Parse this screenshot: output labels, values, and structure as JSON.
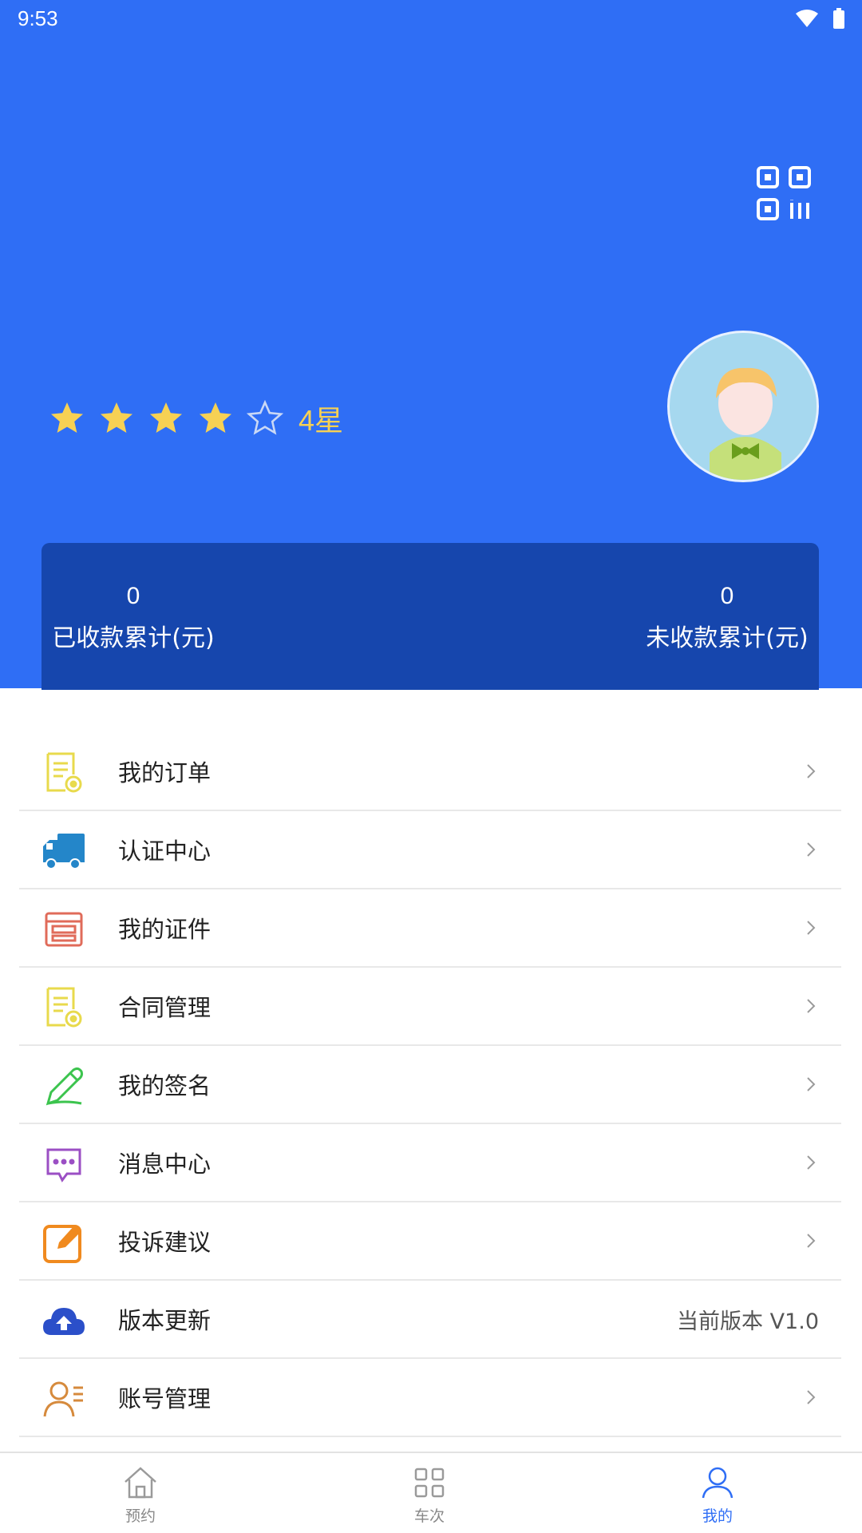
{
  "status_bar": {
    "time": "9:53"
  },
  "profile": {
    "rating_label": "4星",
    "stars_filled": 4,
    "stars_total": 5
  },
  "stats": {
    "received_value": "0",
    "received_label": "已收款累计(元)",
    "unreceived_value": "0",
    "unreceived_label": "未收款累计(元)"
  },
  "menu": {
    "items": [
      {
        "label": "我的订单",
        "icon": "order-document-icon"
      },
      {
        "label": "认证中心",
        "icon": "truck-icon"
      },
      {
        "label": "我的证件",
        "icon": "certificate-icon"
      },
      {
        "label": "合同管理",
        "icon": "contract-document-icon"
      },
      {
        "label": "我的签名",
        "icon": "pen-icon"
      },
      {
        "label": "消息中心",
        "icon": "message-icon"
      },
      {
        "label": "投诉建议",
        "icon": "edit-icon"
      },
      {
        "label": "版本更新",
        "icon": "cloud-upload-icon",
        "value": "当前版本 V1.0"
      },
      {
        "label": "账号管理",
        "icon": "account-icon"
      }
    ]
  },
  "bottom_nav": {
    "items": [
      {
        "label": "预约",
        "icon": "home-icon"
      },
      {
        "label": "车次",
        "icon": "grid-icon"
      },
      {
        "label": "我的",
        "icon": "user-icon",
        "active": true
      }
    ]
  },
  "colors": {
    "header_blue": "#2f6ef5",
    "card_blue": "#1646ad",
    "star_yellow": "#f7d154"
  }
}
